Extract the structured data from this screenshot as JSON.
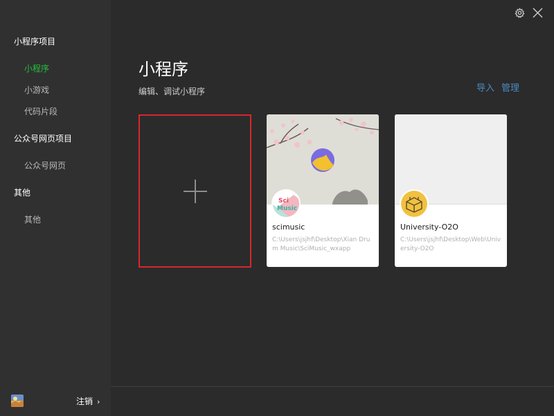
{
  "sidebar": {
    "groups": [
      {
        "label": "小程序项目",
        "items": [
          {
            "label": "小程序",
            "active": true
          },
          {
            "label": "小游戏",
            "active": false
          },
          {
            "label": "代码片段",
            "active": false
          }
        ]
      },
      {
        "label": "公众号网页项目",
        "items": [
          {
            "label": "公众号网页",
            "active": false
          }
        ]
      },
      {
        "label": "其他",
        "items": [
          {
            "label": "其他",
            "active": false
          }
        ]
      }
    ],
    "footer": {
      "logout_label": "注销",
      "chevron": "›"
    }
  },
  "main": {
    "title": "小程序",
    "subtitle": "编辑、调试小程序",
    "actions": {
      "import_label": "导入",
      "manage_label": "管理"
    },
    "topbar_icons": [
      "gear-icon",
      "close-icon"
    ],
    "projects": [
      {
        "name": "scimusic",
        "path": "C:\\Users\\jsjhf\\Desktop\\Xian Drum Music\\SciMusic_wxapp",
        "avatar_text": "Sci Music"
      },
      {
        "name": "University-O2O",
        "path": "C:\\Users\\jsjhf\\Desktop\\Web\\University-O2O"
      }
    ]
  },
  "colors": {
    "background": "#2b2b2b",
    "sidebar": "#303030",
    "active_green": "#25c03b",
    "link_blue": "#4a8bc2",
    "new_card_border": "#d8262d"
  }
}
